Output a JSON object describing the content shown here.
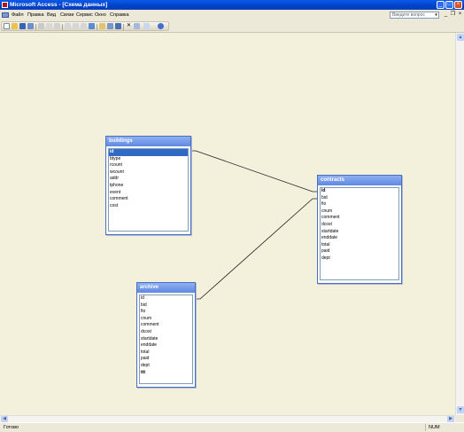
{
  "window": {
    "title": "Microsoft Access - [Схема данных]",
    "buttons": {
      "minimize": "_",
      "maximize": "□",
      "close": "×"
    }
  },
  "menu": {
    "items": [
      "Файл",
      "Правка",
      "Вид",
      "Связи",
      "Сервис",
      "Окно",
      "Справка"
    ],
    "help_placeholder": "Введите вопрос",
    "help_dropdown": "▾",
    "mdi": {
      "minimize": "_",
      "restore": "❐",
      "close": "×"
    }
  },
  "toolbar": {
    "icons": [
      "new-icon",
      "open-icon",
      "save-icon",
      "save-as-icon",
      "print-icon",
      "preview-icon",
      "spelling-icon",
      "cut-icon",
      "copy-icon",
      "paste-icon",
      "undo-icon",
      "show-table-icon",
      "show-direct-icon",
      "show-all-icon",
      "delete-icon",
      "database-window-icon",
      "new-object-icon",
      "help-icon"
    ]
  },
  "tables": {
    "buildings": {
      "title": "buildings",
      "fields": [
        "id",
        "btype",
        "rcount",
        "wcount",
        "addr",
        "tphone",
        "event",
        "comment",
        "cost"
      ]
    },
    "contracts": {
      "title": "contracts",
      "fields": [
        "id",
        "bid",
        "fio",
        "cnum",
        "comment",
        "dcost",
        "startdate",
        "enddate",
        "total",
        "paid",
        "dept"
      ]
    },
    "archive": {
      "title": "archive",
      "fields": [
        "id",
        "bid",
        "fio",
        "cnum",
        "comment",
        "dcost",
        "startdate",
        "enddate",
        "total",
        "paid",
        "dept",
        "ttt"
      ]
    }
  },
  "status": {
    "ready": "Готово",
    "num": "NUM"
  },
  "colors": {
    "titlebar": "#0a5ae8",
    "canvas": "#f3f1dc",
    "table_header": "#7aa0ec",
    "selection": "#316ac5"
  }
}
